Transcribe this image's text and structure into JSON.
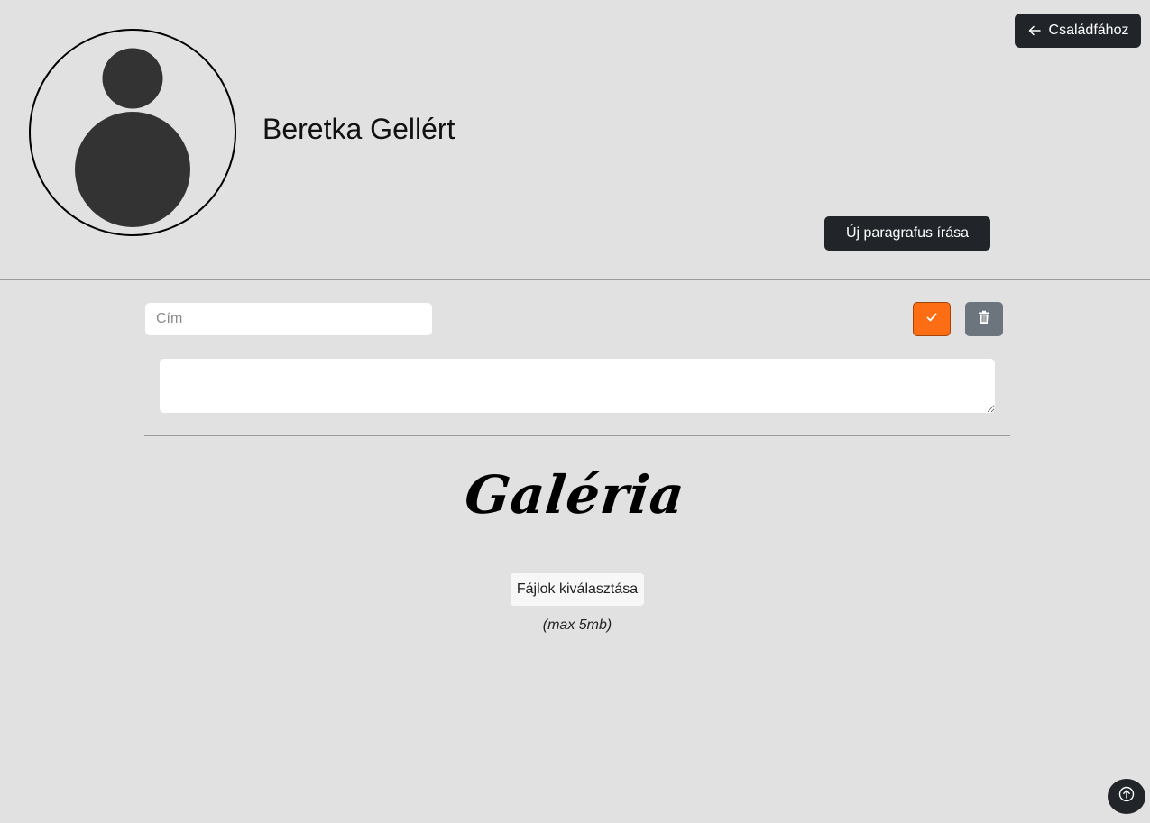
{
  "header": {
    "back_label": "Családfához",
    "back_icon": "arrow-left-icon",
    "person_name": "Beretka Gellért",
    "avatar_icon": "default-person-icon",
    "new_paragraph_label": "Új paragrafus írása"
  },
  "editor": {
    "title_placeholder": "Cím",
    "title_value": "",
    "content_value": "",
    "confirm_icon": "check-icon",
    "delete_icon": "trash-icon",
    "confirm_color": "#fd6d14",
    "delete_color": "#6c757d"
  },
  "gallery": {
    "title": "Galéria",
    "file_button_label": "Fájlok kiválasztása",
    "size_hint": "(max 5mb)"
  },
  "footer": {
    "scroll_top_icon": "arrow-up-circle-icon"
  },
  "colors": {
    "background": "#e1e1e1",
    "dark_button": "#212529"
  }
}
